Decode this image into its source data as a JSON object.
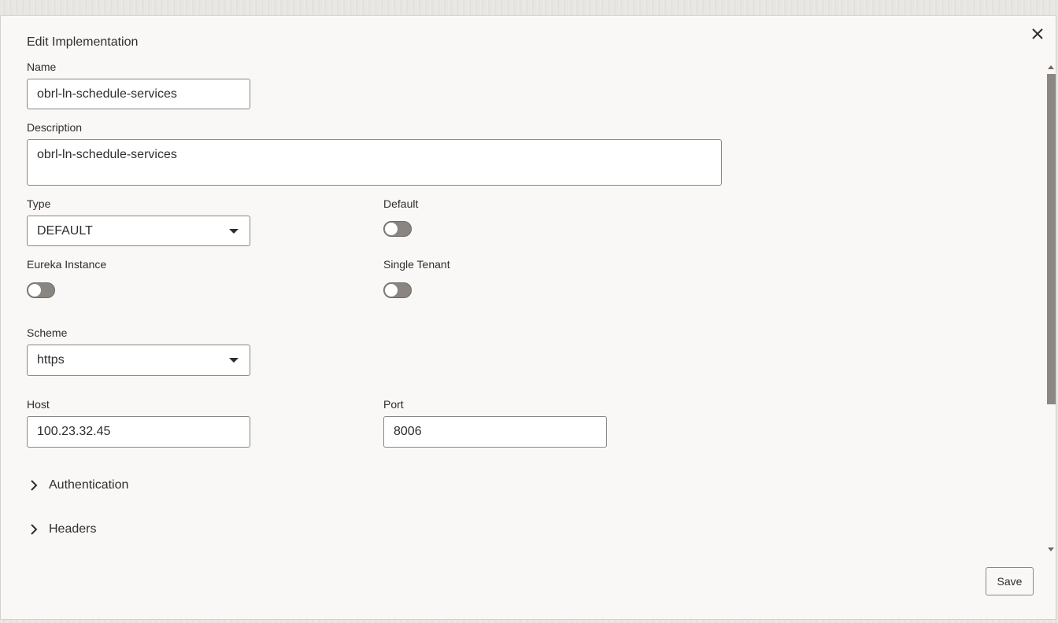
{
  "dialog": {
    "title": "Edit Implementation",
    "close_icon": "close-icon"
  },
  "fields": {
    "name": {
      "label": "Name",
      "value": "obrl-ln-schedule-services"
    },
    "description": {
      "label": "Description",
      "value": "obrl-ln-schedule-services"
    },
    "type": {
      "label": "Type",
      "value": "DEFAULT"
    },
    "default": {
      "label": "Default",
      "checked": false
    },
    "eureka": {
      "label": "Eureka Instance",
      "checked": false
    },
    "single_tenant": {
      "label": "Single Tenant",
      "checked": false
    },
    "scheme": {
      "label": "Scheme",
      "value": "https"
    },
    "host": {
      "label": "Host",
      "value": "100.23.32.45"
    },
    "port": {
      "label": "Port",
      "value": "8006"
    }
  },
  "sections": [
    {
      "label": "Authentication",
      "icon": "chevron-right-icon"
    },
    {
      "label": "Headers",
      "icon": "chevron-right-icon"
    }
  ],
  "footer": {
    "save_label": "Save"
  },
  "colors": {
    "text": "#312d2a",
    "toggle_off": "#8a8580",
    "border": "#8c8782",
    "background": "#f9f8f6"
  }
}
